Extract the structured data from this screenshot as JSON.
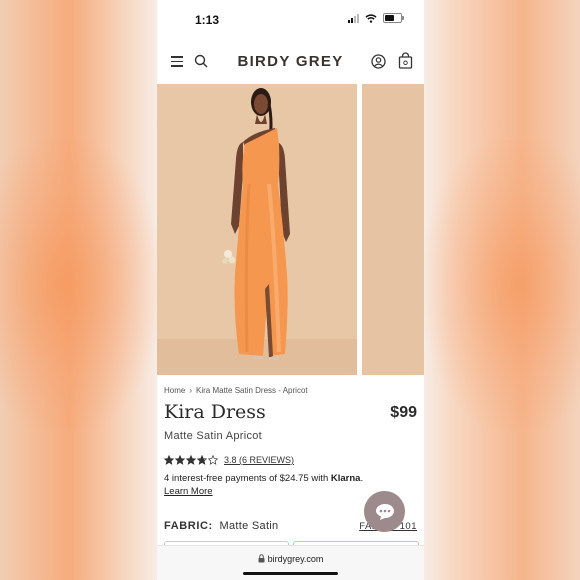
{
  "status_bar": {
    "time": "1:13"
  },
  "header": {
    "brand": "BIRDY GREY"
  },
  "breadcrumb": {
    "home": "Home",
    "current": "Kira Matte Satin Dress - Apricot"
  },
  "product": {
    "title": "Kira Dress",
    "price": "$99",
    "variant": "Matte Satin Apricot",
    "rating_text": "3.8 (6 REVIEWS)",
    "rating_value": 3.8,
    "rating_max": 5
  },
  "klarna": {
    "prefix": "4 interest-free payments of $24.75 with ",
    "brand": "Klarna",
    "suffix": ".",
    "learn_more": "Learn More"
  },
  "fabric": {
    "label": "FABRIC:",
    "value": "Matte Satin",
    "link": "FABRIC 101"
  },
  "browser": {
    "url": "birdygrey.com"
  },
  "colors": {
    "dress": "#f5974f",
    "photo_bg": "#e8c7a7",
    "chat": "#9c8a8c",
    "text": "#2b2b2b"
  }
}
